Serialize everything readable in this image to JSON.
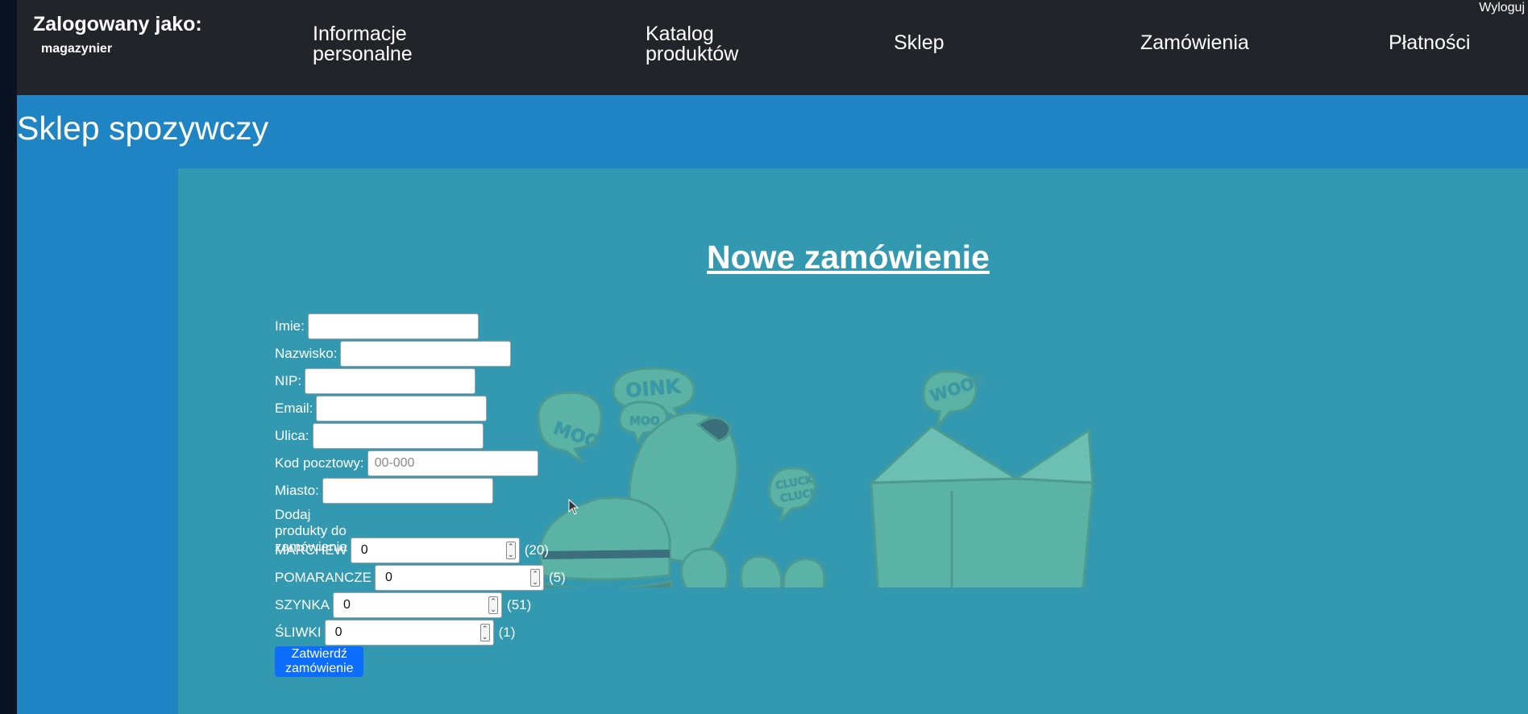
{
  "topbar": {
    "logged_label": "Zalogowany jako:",
    "username": "magazynier",
    "logout_label": "Wyloguj",
    "nav": {
      "personal_info": "Informacje personalne",
      "catalog": "Katalog produktów",
      "shop": "Sklep",
      "orders": "Zamówienia",
      "payments": "Płatności"
    }
  },
  "header": {
    "title": "Sklep spozywczy"
  },
  "form": {
    "title": "Nowe zamówienie",
    "fields": {
      "first_name": {
        "label": "Imie:",
        "value": ""
      },
      "last_name": {
        "label": "Nazwisko:",
        "value": ""
      },
      "nip": {
        "label": "NIP:",
        "value": ""
      },
      "email": {
        "label": "Email:",
        "value": ""
      },
      "street": {
        "label": "Ulica:",
        "value": ""
      },
      "postal_code": {
        "label": "Kod pocztowy:",
        "value": "",
        "placeholder": "00-000"
      },
      "city": {
        "label": "Miasto:",
        "value": ""
      }
    },
    "products_label": "Dodaj produkty do zamówienia",
    "products": [
      {
        "name": "MARCHEW",
        "quantity": "0",
        "stock": "(20)"
      },
      {
        "name": "POMARANCZE",
        "quantity": "0",
        "stock": "(5)"
      },
      {
        "name": "SZYNKA",
        "quantity": "0",
        "stock": "(51)"
      },
      {
        "name": "ŚLIWKI",
        "quantity": "0",
        "stock": "(1)"
      }
    ],
    "submit_label": "Zatwierdź zamówienie"
  },
  "illustration": {
    "bubbles": [
      "MOO",
      "OINK",
      "MOO",
      "WOOF",
      "CLUCK",
      "CLUCK"
    ]
  },
  "colors": {
    "topbar": "#212429",
    "header": "#1e84c4",
    "content": "#3399b0",
    "illustration": "#5bb3a6",
    "button": "#0d6efd"
  }
}
